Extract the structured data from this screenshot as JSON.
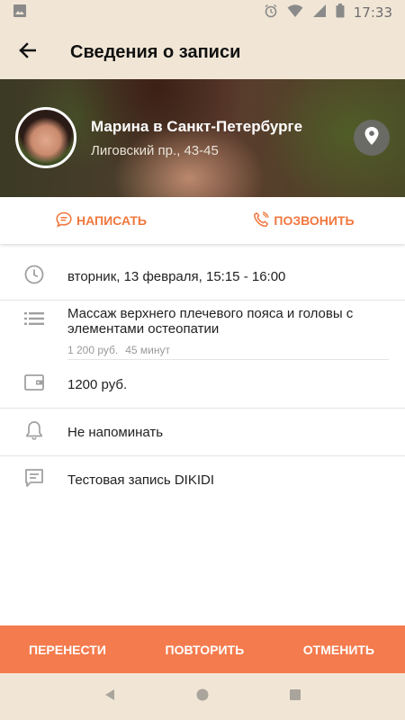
{
  "status_bar": {
    "time": "17:33",
    "icons": [
      "image-icon",
      "alarm-icon",
      "wifi-icon",
      "signal-icon",
      "battery-icon"
    ]
  },
  "app_bar": {
    "title": "Сведения о записи",
    "back_icon": "arrow-left-icon"
  },
  "venue": {
    "name": "Марина в Санкт-Петербурге",
    "address": "Лиговский пр., 43-45",
    "location_icon": "map-pin-icon"
  },
  "actions": {
    "write_label": "НАПИСАТЬ",
    "call_label": "ПОЗВОНИТЬ"
  },
  "details": {
    "datetime": "вторник, 13 февраля, 15:15 - 16:00",
    "service": {
      "title": "Массаж верхнего плечевого пояса и головы с элементами остеопатии",
      "price": "1 200 руб.",
      "duration": "45 минут"
    },
    "total": "1200 руб.",
    "reminder": "Не напоминать",
    "comment": "Тестовая запись DIKIDI"
  },
  "bottom_bar": {
    "reschedule_label": "ПЕРЕНЕСТИ",
    "repeat_label": "ПОВТОРИТЬ",
    "cancel_label": "ОТМЕНИТЬ"
  },
  "colors": {
    "accent": "#f47b4d",
    "accent_text": "#f1773e",
    "bar_background": "#f1e6d6",
    "icon_gray": "#a0a0a0"
  }
}
